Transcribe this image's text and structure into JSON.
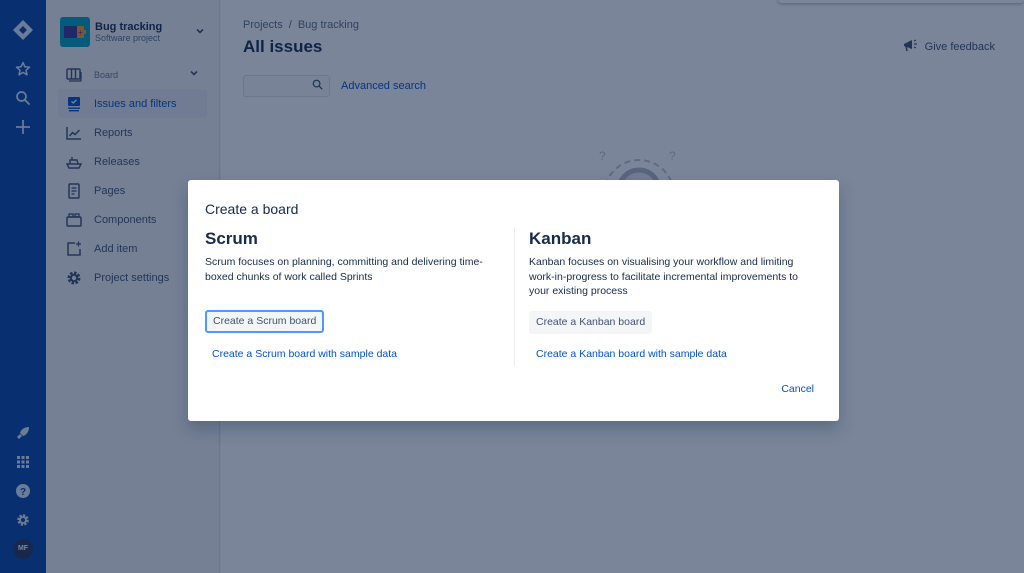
{
  "global_nav": {
    "top_icons": [
      "jira-logo-icon",
      "star-icon",
      "search-icon",
      "plus-icon"
    ],
    "bottom_icons": [
      "rocket-icon",
      "app-switcher-icon",
      "help-icon",
      "settings-icon"
    ],
    "avatar_initials": "MF"
  },
  "sidebar": {
    "project_name": "Bug tracking",
    "project_type": "Software project",
    "items": [
      {
        "label": "Board",
        "icon": "board-icon",
        "has_chevron": true
      },
      {
        "label": "Issues and filters",
        "icon": "issues-icon",
        "active": true
      },
      {
        "label": "Reports",
        "icon": "reports-icon"
      },
      {
        "label": "Releases",
        "icon": "releases-icon"
      },
      {
        "label": "Pages",
        "icon": "pages-icon"
      },
      {
        "label": "Components",
        "icon": "components-icon"
      },
      {
        "label": "Add item",
        "icon": "add-item-icon"
      },
      {
        "label": "Project settings",
        "icon": "settings-icon"
      }
    ]
  },
  "main": {
    "breadcrumb": [
      "Projects",
      "Bug tracking"
    ],
    "breadcrumb_sep": "/",
    "title": "All issues",
    "feedback_label": "Give feedback",
    "search_placeholder": "",
    "advanced_search_label": "Advanced search"
  },
  "modal": {
    "title": "Create a board",
    "scrum": {
      "heading": "Scrum",
      "description": "Scrum focuses on planning, committing and delivering time-boxed chunks of work called Sprints",
      "button_label": "Create a Scrum board",
      "sample_link": "Create a Scrum board with sample data"
    },
    "kanban": {
      "heading": "Kanban",
      "description": "Kanban focuses on visualising your workflow and limiting work-in-progress to facilitate incremental improvements to your existing process",
      "button_label": "Create a Kanban board",
      "sample_link": "Create a Kanban board with sample data"
    },
    "cancel_label": "Cancel"
  },
  "colors": {
    "nav_blue": "#0747a6",
    "link_blue": "#0052cc",
    "focus_ring": "#4c9aff",
    "text_dark": "#172b4d"
  }
}
